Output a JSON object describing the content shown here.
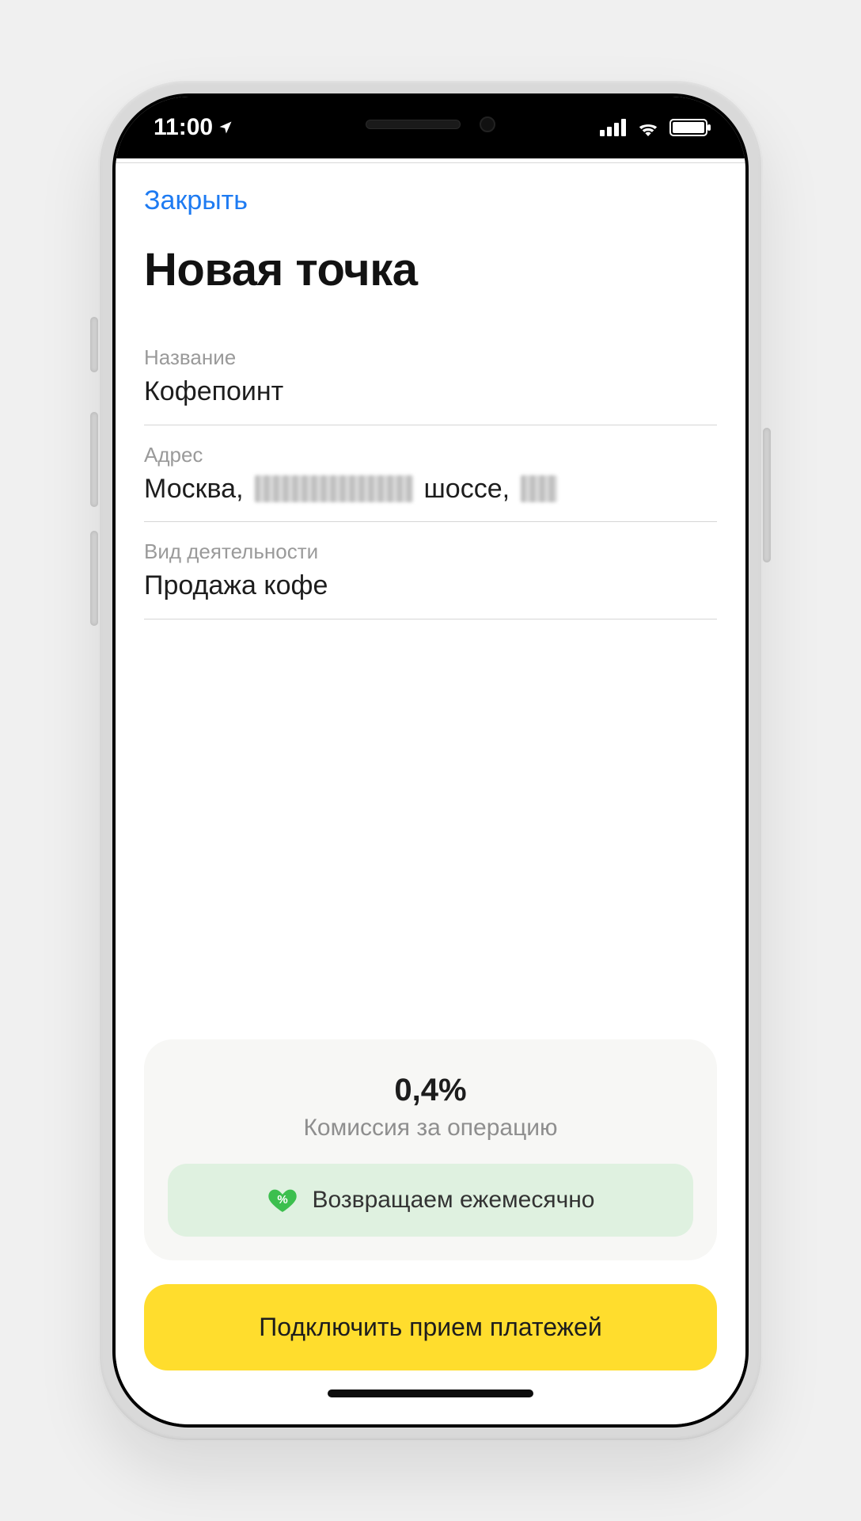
{
  "status": {
    "time": "11:00"
  },
  "header": {
    "close_label": "Закрыть",
    "title": "Новая точка"
  },
  "fields": {
    "name": {
      "label": "Название",
      "value": "Кофепоинт"
    },
    "address": {
      "label": "Адрес",
      "prefix": "Москва,",
      "middle": "шоссе,"
    },
    "activity": {
      "label": "Вид деятельности",
      "value": "Продажа кофе"
    }
  },
  "fee": {
    "value": "0,4%",
    "label": "Комиссия за операцию",
    "cashback_text": "Возвращаем ежемесячно"
  },
  "cta": {
    "label": "Подключить прием платежей"
  },
  "colors": {
    "accent_link": "#1e7bf2",
    "button_bg": "#ffdd2d",
    "cashback_bg": "#dff1e0",
    "cashback_icon": "#3cbf4e"
  }
}
